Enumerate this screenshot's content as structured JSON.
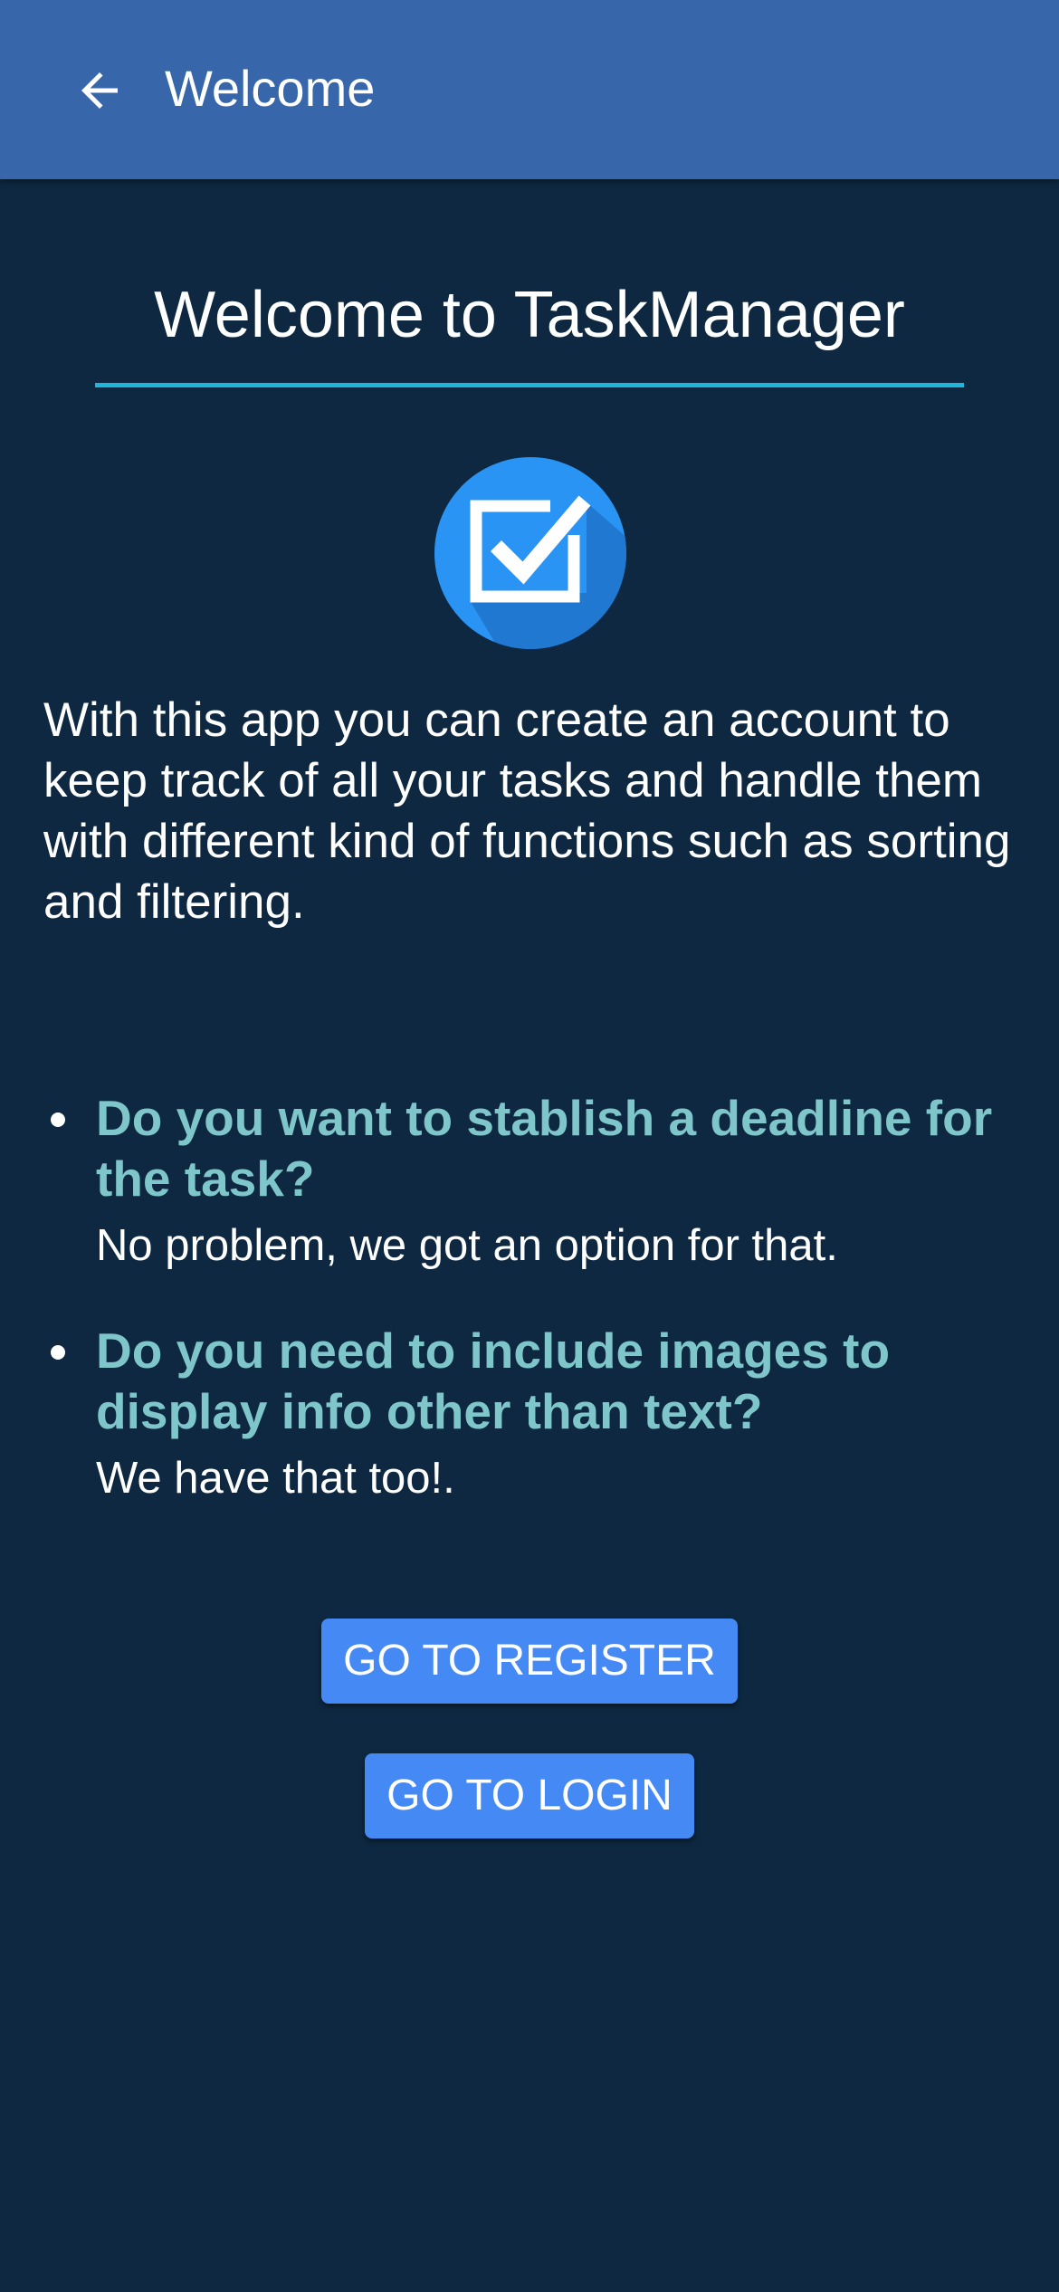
{
  "app_bar": {
    "back_icon": "arrow-left-icon",
    "title": "Welcome"
  },
  "hero": {
    "title": "Welcome to TaskManager",
    "divider_color": "#1eb6da",
    "logo_icon": "checkbox-checked-icon"
  },
  "intro": "With this app you can create an account to keep track of all your tasks and handle them with different kind of functions such as sorting and filtering.",
  "features": [
    {
      "question": "Do you want to stablish a deadline for the task?",
      "answer": "No problem, we got an option for that."
    },
    {
      "question": "Do you need to include images to display info other than text?",
      "answer": "We have that too!."
    }
  ],
  "actions": {
    "register_label": "GO TO REGISTER",
    "login_label": "GO TO LOGIN"
  },
  "colors": {
    "background": "#0d2840",
    "app_bar": "#3766ab",
    "accent_question": "#7fc6cb",
    "button": "#4589f5"
  }
}
